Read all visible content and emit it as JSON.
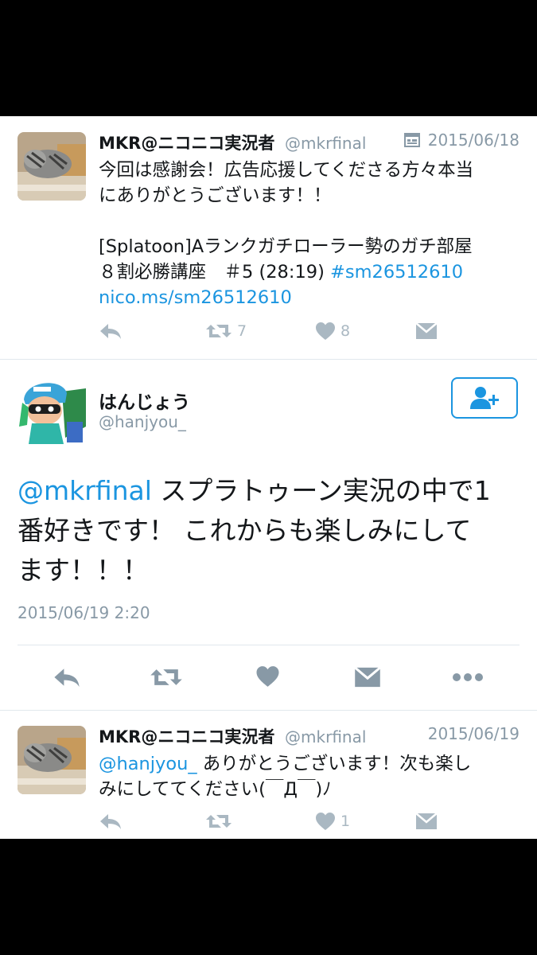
{
  "tweets": {
    "first": {
      "username": "MKR@ニコニコ実況者",
      "handle": "@mkrfinal",
      "date": "2015/06/18",
      "line1": "今回は感謝会！広告応援してくださる方々本当",
      "line2": "にありがとうございます！！",
      "line3": " [Splatoon]Aランクガチローラー勢のガチ部屋",
      "line4_text": "８割必勝講座　＃5 (28:19) ",
      "hashtag": "#sm26512610",
      "short_link": "nico.ms/sm26512610",
      "retweets": "7",
      "likes": "8"
    },
    "focused": {
      "username": "はんじょう",
      "handle": "@hanjyou_",
      "mention": "@mkrfinal",
      "text_part1": " スプラトゥーン実況の中で1",
      "text_line2": "番好きです！ これからも楽しみにして",
      "text_line3": "ます！！！",
      "timestamp": "2015/06/19 2:20"
    },
    "reply": {
      "username": "MKR@ニコニコ実況者",
      "handle": "@mkrfinal",
      "date": "2015/06/19",
      "mention": "@hanjyou_",
      "text_part1": " ありがとうございます！次も楽し",
      "text_line2": "みにしててください(￣Д￣)ﾉ",
      "likes": "1"
    }
  },
  "colors": {
    "accent": "#1b95e0",
    "muted": "#8899a6",
    "icon_gray": "#aab8c2",
    "background_bars": "#000000"
  },
  "icons": [
    "reply-icon",
    "retweet-icon",
    "like-icon",
    "dm-icon",
    "more-icon",
    "follow-icon",
    "calendar-icon"
  ]
}
